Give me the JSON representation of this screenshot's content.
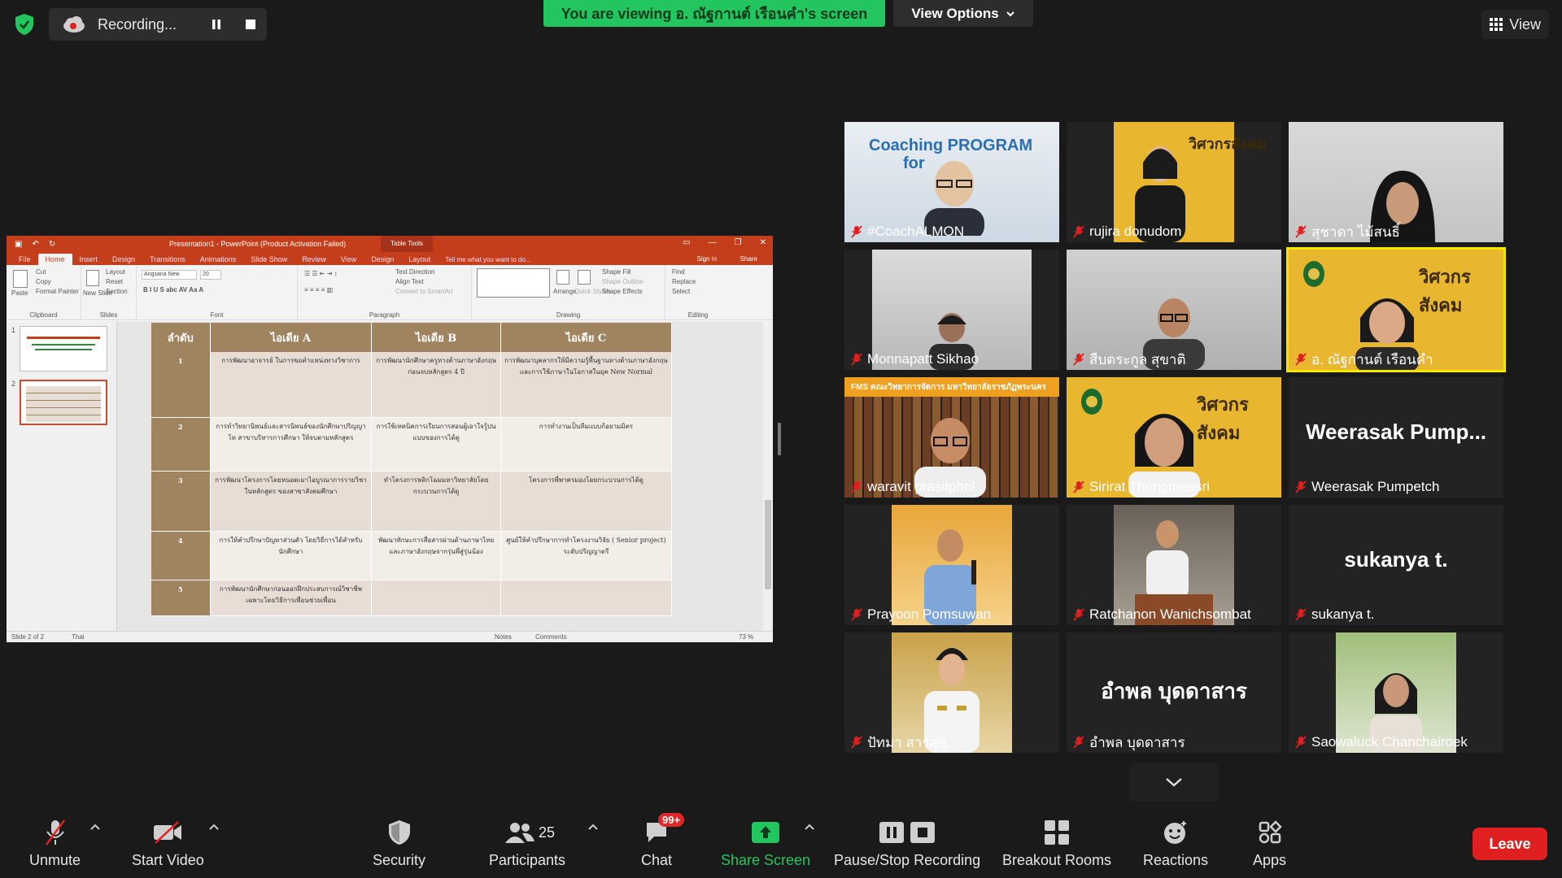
{
  "top_bar": {
    "recording_label": "Recording...",
    "viewing_banner": "You are viewing อ. ณัฐกานต์  เรือนคำ's screen",
    "view_options_label": "View Options",
    "view_label": "View"
  },
  "ppt": {
    "window_title": "Presentation1 - PowerPoint (Product Activation Failed)",
    "context_tab": "Table Tools",
    "tabs": [
      "File",
      "Home",
      "Insert",
      "Design",
      "Transitions",
      "Animations",
      "Slide Show",
      "Review",
      "View",
      "Design",
      "Layout"
    ],
    "tell_me": "Tell me what you want to do...",
    "sign_in": "Sign in",
    "share": "Share",
    "font_name": "Angsana New",
    "font_size": "20",
    "groups": {
      "clipboard": "Clipboard",
      "slides": "Slides",
      "font": "Font",
      "paragraph": "Paragraph",
      "drawing": "Drawing",
      "editing": "Editing"
    },
    "clipboard_items": [
      "Cut",
      "Copy",
      "Format Painter"
    ],
    "paste": "Paste",
    "slides_items": [
      "Layout",
      "Reset",
      "Section"
    ],
    "new_slide": "New Slide",
    "paragraph_items": [
      "Text Direction",
      "Align Text",
      "Convert to SmartArt"
    ],
    "drawing_items": [
      "Shape Fill",
      "Shape Outline",
      "Shape Effects"
    ],
    "arrange": "Arrange",
    "quick_styles": "Quick Styles",
    "editing_items": [
      "Find",
      "Replace",
      "Select"
    ],
    "table": {
      "headers": [
        "ลำดับ",
        "ไอเดีย A",
        "ไอเดีย B",
        "ไอเดีย C"
      ],
      "rows": [
        {
          "num": "1",
          "a": "การพัฒนาอาจารย์ ในการขอตำแหน่งทางวิชาการ",
          "b": "การพัฒนานักศึกษาครูทางด้านภาษาอังกฤษก่อนจบหลักสูตร 4 ปี",
          "c": "การพัฒนาบุคลากรให้มีความรู้พื้นฐานทางด้านภาษาอังกฤษและการใช้ภาษาในโอกาสในยุค New Normal"
        },
        {
          "num": "2",
          "a": "การทำวิทยานิพนธ์และสารนิพนธ์ของนักศึกษาปริญญาโท สาขาบริหารการศึกษา ให้จบตามหลักสูตร",
          "b": "การใช้เทคนิคการเรียนการสอนผู้เอาใจรู้ปนแบบของการได้ดู",
          "c": "การทำงานเป็นทีมแบบก้อยามมิตร"
        },
        {
          "num": "3",
          "a": "การพัฒนาโครงการโดยหนอตเมาไอบูรณาการรายวิชาในหลักสูตร ของสาขาสังคมศึกษา",
          "b": "ทำโครงการพลิกโฉมมหาวิทยาลัยโดยกระบวนการได้ดู",
          "c": "โครงการพี่พาครมองโดยกระบวนการได้ดู"
        },
        {
          "num": "4",
          "a": "การให้คำปรึกษาปัญหาส่วนตัว โดยวิธีการได้สำหรับนักศึกษา",
          "b": "พัฒนาทักษะการสื่อสารผ่านด้านภาษาไทยและภาษาอังกฤษจากรุ่นพี่สู่รุ่นน้อง",
          "c": "ศูนย์ให้คำปรึกษาการทำโครงงานวิจัย ( Senior project) ระดับปริญญาตรี"
        },
        {
          "num": "5",
          "a": "การพัฒนานักศึกษาก่อนออกฝึกประสบการณ์วิชาชีพ เฉพาะโดยวิธีการเพื่อนช่วยเพื่อน",
          "b": "",
          "c": ""
        }
      ]
    },
    "status_left": "Slide 2 of 2",
    "status_lang": "Thai",
    "status_notes": "Notes",
    "status_comments": "Comments",
    "zoom": "73 %"
  },
  "participants": [
    {
      "name": "#CoachALMON"
    },
    {
      "name": "rujira donudom"
    },
    {
      "name": "สุชาดา ไม้สนธิ์"
    },
    {
      "name": "Monnapatt Sikhao"
    },
    {
      "name": "สืบตระกูล สุขาติ"
    },
    {
      "name": "อ. ณัฐกานต์  เรือนคำ"
    },
    {
      "name": "waravit prasitphol"
    },
    {
      "name": "Sirirat Thongmeesri"
    },
    {
      "name": "Weerasak Pumpetch",
      "display": "Weerasak  Pump..."
    },
    {
      "name": "Prayoon Pomsuwan"
    },
    {
      "name": "Ratchanon Wanichsombat"
    },
    {
      "name": "sukanya t.",
      "display": "sukanya t."
    },
    {
      "name": "ปัทมา สารสุข"
    },
    {
      "name": "อำพล บุดดาสาร",
      "display": "อำพล บุดดาสาร"
    },
    {
      "name": "Saowaluck Chanchairoek"
    }
  ],
  "tile_text": {
    "coach_banner": "Coaching PROGRAM",
    "coach_banner2": "for",
    "org_brand": "วิศวกรสังคม",
    "fms_banner": "FMS คณะวิทยาการจัดการ มหาวิทยาลัยราชภัฏพระนคร"
  },
  "toolbar": {
    "unmute": "Unmute",
    "start_video": "Start Video",
    "security": "Security",
    "participants": "Participants",
    "participant_count": "25",
    "chat": "Chat",
    "chat_badge": "99+",
    "share_screen": "Share Screen",
    "pause_stop": "Pause/Stop Recording",
    "breakout": "Breakout Rooms",
    "reactions": "Reactions",
    "apps": "Apps",
    "leave": "Leave"
  },
  "colors": {
    "banner_green": "#23c55e",
    "ppt_red": "#c43e1c",
    "leave_red": "#e02020",
    "active_speaker": "#f5e800"
  }
}
